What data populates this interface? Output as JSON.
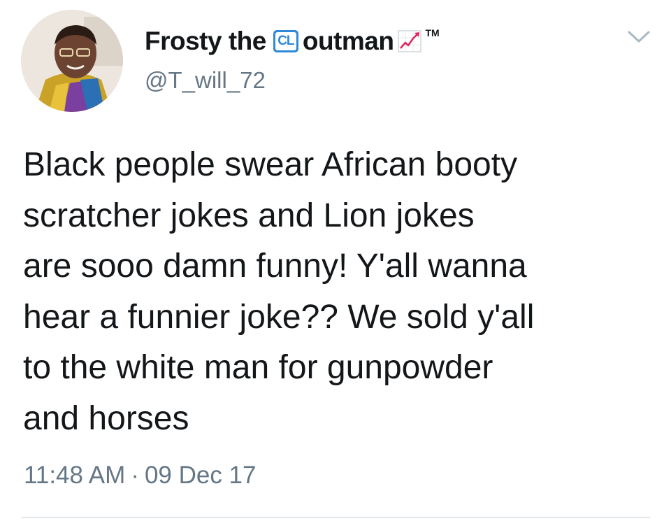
{
  "user": {
    "name_part1": "Frosty the",
    "badge_text": "CL",
    "name_part2": "outman",
    "trademark": "TM",
    "handle": "@T_will_72"
  },
  "tweet": {
    "lines": [
      "Black people swear African booty",
      "scratcher jokes and Lion jokes",
      "are sooo damn funny! Y'all wanna",
      "hear a funnier joke?? We sold y'all",
      "to the white man for gunpowder",
      "and horses"
    ],
    "time": "11:48 AM",
    "separator": "·",
    "date": "09 Dec 17"
  },
  "icons": {
    "badge": "cl-badge-icon",
    "chart": "chart-increasing-icon",
    "menu": "chevron-down-icon"
  },
  "colors": {
    "text": "#14171a",
    "secondary": "#657786",
    "badge_blue": "#2e89d8",
    "chart_red": "#e0245e",
    "divider": "#e1e8ed"
  }
}
